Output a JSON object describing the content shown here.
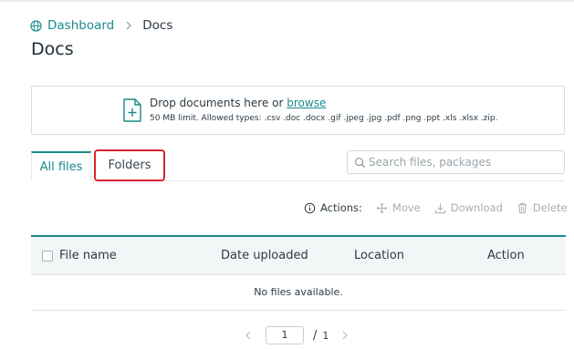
{
  "breadcrumb": {
    "home": "Dashboard",
    "current": "Docs"
  },
  "page": {
    "title": "Docs"
  },
  "upload": {
    "prompt": "Drop documents here or ",
    "browse": "browse",
    "limits": "50 MB limit. Allowed types: .csv .doc .docx .gif .jpeg .jpg .pdf .png .ppt .xls .xlsx .zip."
  },
  "tabs": [
    {
      "label": "All files",
      "active": true
    },
    {
      "label": "Folders",
      "active": false,
      "highlighted": true
    }
  ],
  "search": {
    "placeholder": "Search files, packages",
    "value": ""
  },
  "actions": {
    "label": "Actions:",
    "move": "Move",
    "download": "Download",
    "delete": "Delete"
  },
  "table": {
    "columns": [
      "File name",
      "Date uploaded",
      "Location",
      "Action"
    ],
    "empty_message": "No files available."
  },
  "pagination": {
    "current": "1",
    "separator": "/",
    "total": "1"
  },
  "colors": {
    "accent": "#1b8a8a",
    "highlight": "#d8232a",
    "disabled": "#a6aeb3"
  },
  "icons": [
    "globe-icon",
    "chevron-right-icon",
    "file-add-icon",
    "search-icon",
    "info-icon",
    "move-icon",
    "download-icon",
    "trash-icon",
    "chevron-left-icon"
  ]
}
